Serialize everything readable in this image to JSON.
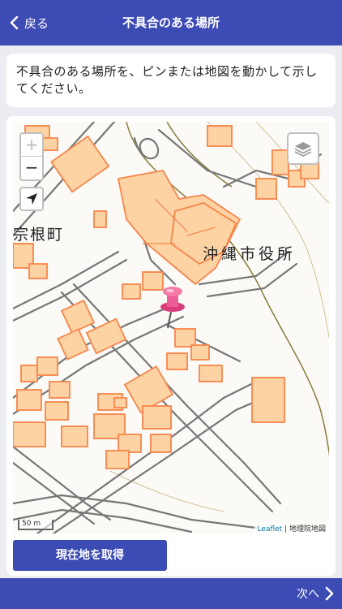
{
  "header": {
    "back_label": "戻る",
    "title": "不具合のある場所"
  },
  "instruction": {
    "text": "不具合のある場所を、ピンまたは地図を動かして示してください。"
  },
  "map": {
    "zoom_in": "+",
    "zoom_out": "−",
    "locate_icon": "navigation-arrow-icon",
    "layers_icon": "layers-icon",
    "labels": {
      "town": "宗根町",
      "city_hall": "沖縄市役所"
    },
    "scale": "50 m",
    "attribution_link": "Leaflet",
    "attribution_sep": " | ",
    "attribution_source": "地理院地図",
    "colors": {
      "building_fill": "#fdd3a3",
      "building_stroke": "#f7854a",
      "road": "#777777",
      "contour": "#8c7a3a"
    }
  },
  "actions": {
    "get_location_label": "現在地を取得"
  },
  "footer": {
    "next_label": "次へ"
  },
  "colors": {
    "primary": "#3d4bb5",
    "background": "#ececf3"
  }
}
